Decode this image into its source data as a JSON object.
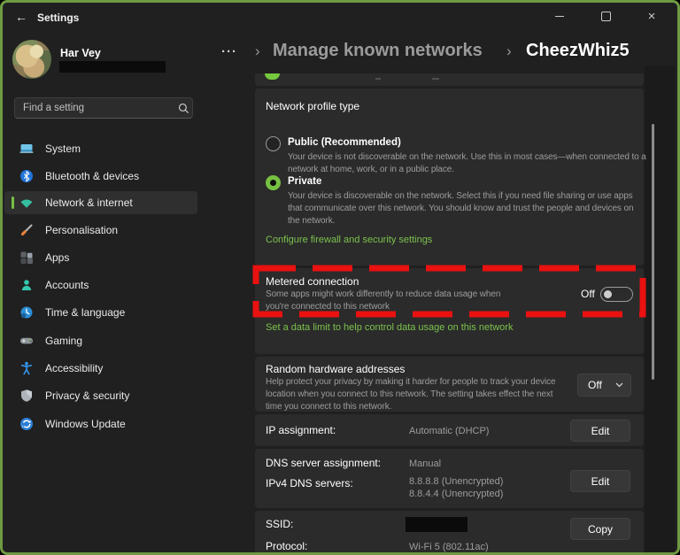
{
  "colors": {
    "accent_green": "#76c043",
    "link_green": "#7cc24d",
    "highlight_red": "#ea1111",
    "window_border_green": "#6e9a43"
  },
  "titlebar": {
    "title": "Settings",
    "back": "←",
    "close": "×"
  },
  "user": {
    "name": "Har Vey"
  },
  "search": {
    "placeholder": "Find a setting"
  },
  "sidebar": {
    "items": [
      {
        "label": "System"
      },
      {
        "label": "Bluetooth & devices"
      },
      {
        "label": "Network & internet",
        "selected": true
      },
      {
        "label": "Personalisation"
      },
      {
        "label": "Apps"
      },
      {
        "label": "Accounts"
      },
      {
        "label": "Time & language"
      },
      {
        "label": "Gaming"
      },
      {
        "label": "Accessibility"
      },
      {
        "label": "Privacy & security"
      },
      {
        "label": "Windows Update"
      }
    ]
  },
  "breadcrumb": {
    "more": "···",
    "separator": "›",
    "parent": "Manage known networks",
    "current": "CheezWhiz5"
  },
  "network_profile": {
    "title": "Network profile type",
    "options": [
      {
        "label": "Public (Recommended)",
        "selected": false,
        "description": "Your device is not discoverable on the network. Use this in most cases—when connected to a\nnetwork at home, work, or in a public place."
      },
      {
        "label": "Private",
        "selected": true,
        "description": "Your device is discoverable on the network. Select this if you need file sharing or use apps\nthat communicate over this network. You should know and trust the people and devices on\nthe network."
      }
    ],
    "link": "Configure firewall and security settings"
  },
  "metered": {
    "title": "Metered connection",
    "description": "Some apps might work differently to reduce data usage when\nyou're connected to this network",
    "toggle_state": "Off",
    "link": "Set a data limit to help control data usage on this network"
  },
  "random_hardware": {
    "title": "Random hardware addresses",
    "description": "Help protect your privacy by making it harder for people to track your device\nlocation when you connect to this network. The setting takes effect the next\ntime you connect to this network.",
    "dropdown_value": "Off"
  },
  "ip_assignment": {
    "label": "IP assignment:",
    "value": "Automatic (DHCP)",
    "button": "Edit"
  },
  "dns": {
    "label1": "DNS server assignment:",
    "value1": "Manual",
    "label2": "IPv4 DNS servers:",
    "value2": "8.8.8.8 (Unencrypted)\n8.8.4.4 (Unencrypted)",
    "button": "Edit"
  },
  "ssid": {
    "label1": "SSID:",
    "label2": "Protocol:",
    "value2": "Wi-Fi 5 (802.11ac)",
    "button": "Copy"
  }
}
